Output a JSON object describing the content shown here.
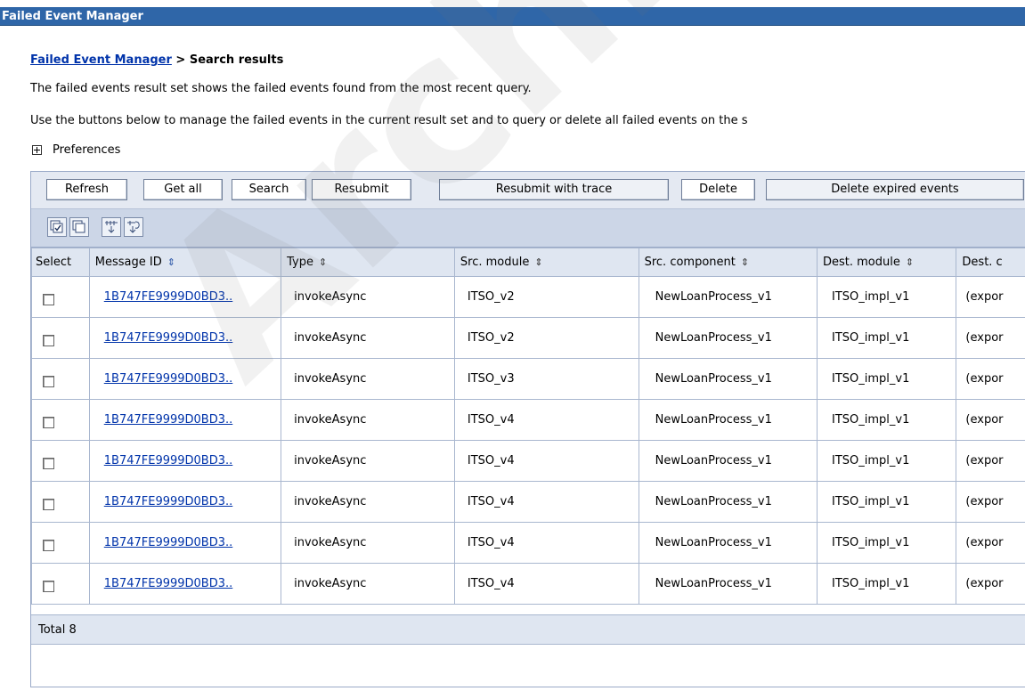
{
  "window": {
    "title": "Failed Event Manager"
  },
  "breadcrumb": {
    "link": "Failed Event Manager",
    "separator": " > ",
    "current": "Search results"
  },
  "description": {
    "line1": "The failed events result set shows the failed events found from the most recent query.",
    "line2": "Use the buttons below to manage the failed events in the current result set and to query or delete all failed events on the s"
  },
  "preferences": {
    "label": "Preferences"
  },
  "toolbar": {
    "buttons": [
      "Refresh",
      "Get all",
      "Search",
      "Resubmit",
      "Resubmit with trace",
      "Delete",
      "Delete expired events"
    ]
  },
  "icon_toolbar": {
    "icons": [
      "select-all-icon",
      "deselect-all-icon",
      "show-filter-icon",
      "clear-filter-icon"
    ]
  },
  "table": {
    "columns": [
      "Select",
      "Message ID",
      "Type",
      "Src. module",
      "Src. component",
      "Dest. module",
      "Dest. c"
    ],
    "rows": [
      [
        "1B747FE9999D0BD3..",
        "invokeAsync",
        "ITSO_v2",
        "NewLoanProcess_v1",
        "ITSO_impl_v1",
        "(expor"
      ],
      [
        "1B747FE9999D0BD3..",
        "invokeAsync",
        "ITSO_v2",
        "NewLoanProcess_v1",
        "ITSO_impl_v1",
        "(expor"
      ],
      [
        "1B747FE9999D0BD3..",
        "invokeAsync",
        "ITSO_v3",
        "NewLoanProcess_v1",
        "ITSO_impl_v1",
        "(expor"
      ],
      [
        "1B747FE9999D0BD3..",
        "invokeAsync",
        "ITSO_v4",
        "NewLoanProcess_v1",
        "ITSO_impl_v1",
        "(expor"
      ],
      [
        "1B747FE9999D0BD3..",
        "invokeAsync",
        "ITSO_v4",
        "NewLoanProcess_v1",
        "ITSO_impl_v1",
        "(expor"
      ],
      [
        "1B747FE9999D0BD3..",
        "invokeAsync",
        "ITSO_v4",
        "NewLoanProcess_v1",
        "ITSO_impl_v1",
        "(expor"
      ],
      [
        "1B747FE9999D0BD3..",
        "invokeAsync",
        "ITSO_v4",
        "NewLoanProcess_v1",
        "ITSO_impl_v1",
        "(expor"
      ],
      [
        "1B747FE9999D0BD3..",
        "invokeAsync",
        "ITSO_v4",
        "NewLoanProcess_v1",
        "ITSO_impl_v1",
        "(expor"
      ]
    ],
    "total": "Total 8"
  },
  "watermark": "Archived",
  "colors": {
    "titlebar": "#2f66a8",
    "link": "#0033aa",
    "header_bg": "#dfe6f1"
  }
}
